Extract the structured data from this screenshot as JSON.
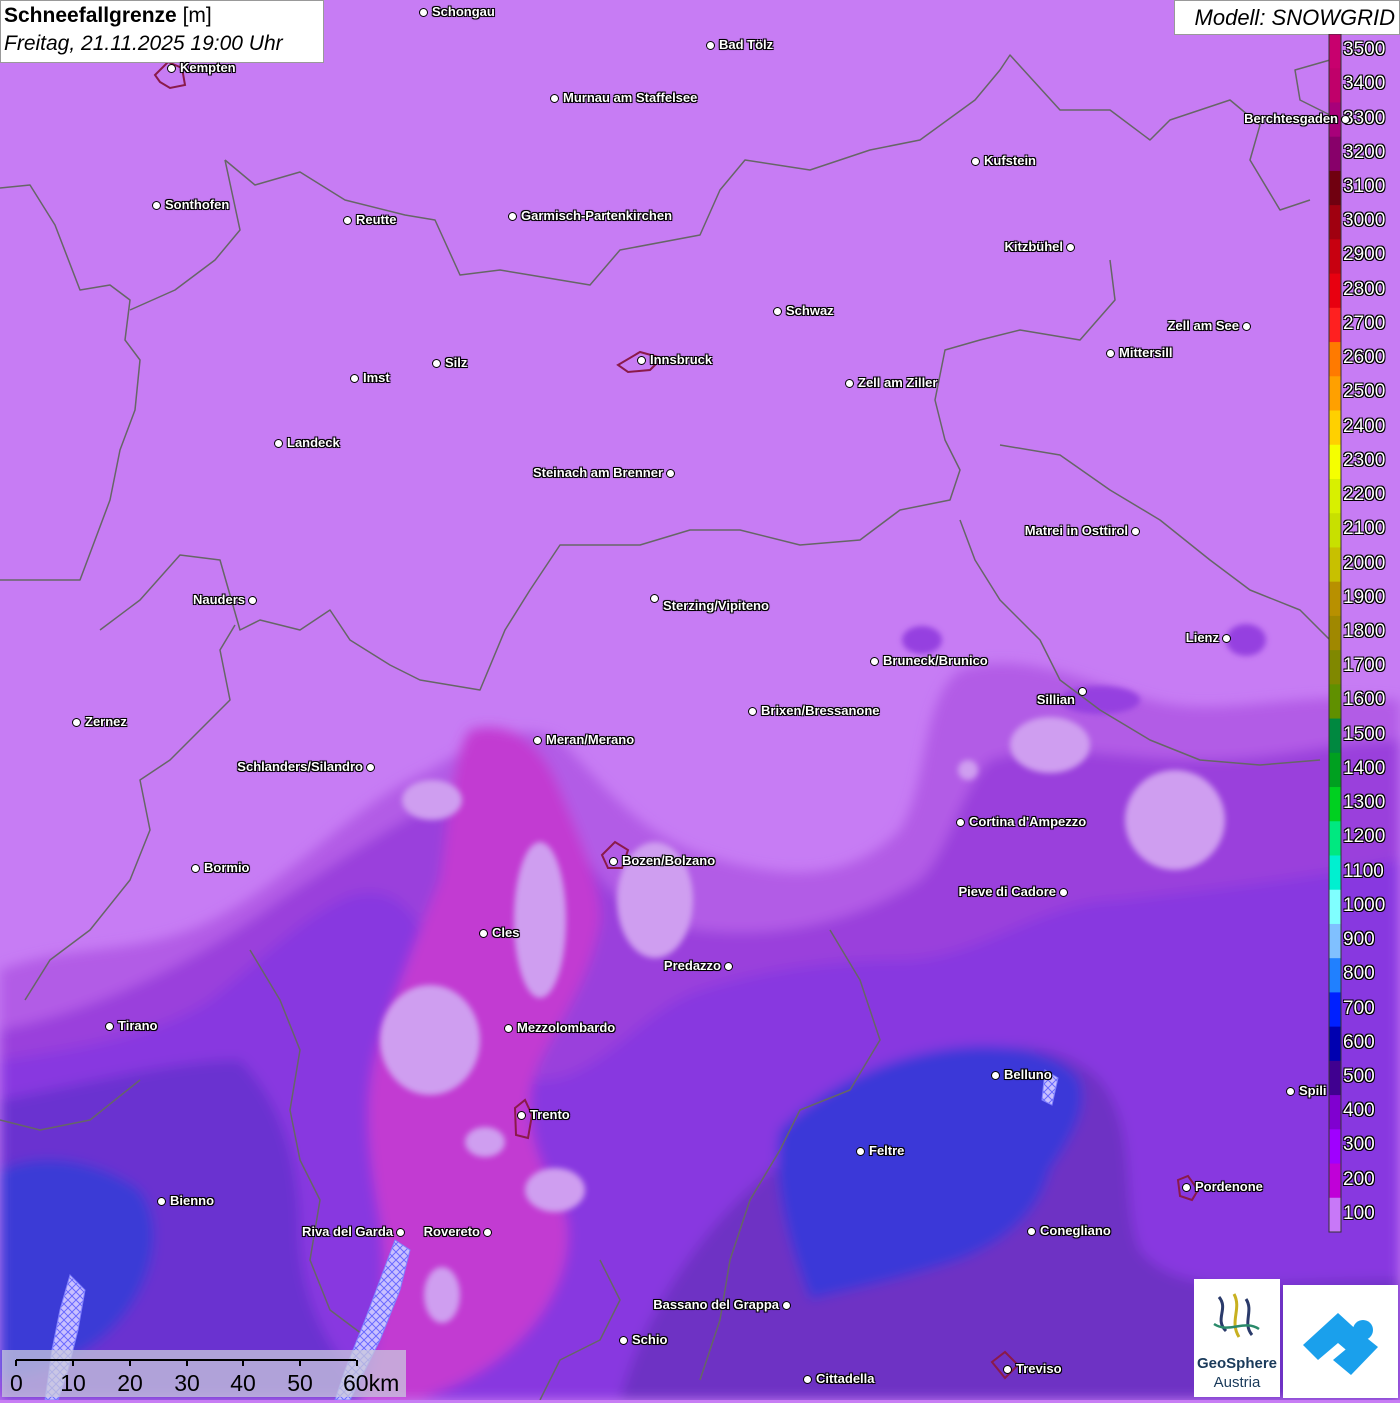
{
  "title": {
    "variable": "Schneefallgrenze",
    "unit": "[m]",
    "datetime": "Freitag, 21.11.2025 19:00 Uhr"
  },
  "model": "Modell: SNOWGRID",
  "legend": {
    "labels": [
      "3500",
      "3400",
      "3300",
      "3200",
      "3100",
      "3000",
      "2900",
      "2800",
      "2700",
      "2600",
      "2500",
      "2400",
      "2300",
      "2200",
      "2100",
      "2000",
      "1900",
      "1800",
      "1700",
      "1600",
      "1500",
      "1400",
      "1300",
      "1200",
      "1100",
      "1000",
      "900",
      "800",
      "700",
      "600",
      "500",
      "400",
      "300",
      "200",
      "100"
    ],
    "colors": [
      "#c8006e",
      "#c0006a",
      "#a8007a",
      "#88006a",
      "#700010",
      "#a00010",
      "#c80010",
      "#e80010",
      "#ff2020",
      "#ff7a00",
      "#ffa000",
      "#ffd000",
      "#f5ff00",
      "#d8f000",
      "#c8e000",
      "#c8c000",
      "#b89000",
      "#a08800",
      "#808800",
      "#609000",
      "#008840",
      "#00a020",
      "#00d020",
      "#00e880",
      "#00f0d0",
      "#80ffff",
      "#80c0ff",
      "#2080ff",
      "#0020ff",
      "#0000b0",
      "#400090",
      "#8000d0",
      "#a000ff",
      "#c000d8",
      "#c878f8"
    ]
  },
  "cities": [
    {
      "name": "Schongau"
    },
    {
      "name": "Bad Tölz"
    },
    {
      "name": "Kempten"
    },
    {
      "name": "Murnau am Staffelsee"
    },
    {
      "name": "Berchtesgaden"
    },
    {
      "name": "Kufstein"
    },
    {
      "name": "Sonthofen"
    },
    {
      "name": "Reutte"
    },
    {
      "name": "Garmisch-Partenkirchen"
    },
    {
      "name": "Kitzbühel"
    },
    {
      "name": "Schwaz"
    },
    {
      "name": "Zell am See"
    },
    {
      "name": "Mittersill"
    },
    {
      "name": "Innsbruck"
    },
    {
      "name": "Imst"
    },
    {
      "name": "Silz"
    },
    {
      "name": "Zell am Ziller"
    },
    {
      "name": "Landeck"
    },
    {
      "name": "Steinach am Brenner"
    },
    {
      "name": "Matrei in Osttirol"
    },
    {
      "name": "Nauders"
    },
    {
      "name": "Sterzing/Vipiteno"
    },
    {
      "name": "Lienz"
    },
    {
      "name": "Bruneck/Brunico"
    },
    {
      "name": "Sillian"
    },
    {
      "name": "Zernez"
    },
    {
      "name": "Brixen/Bressanone"
    },
    {
      "name": "Meran/Merano"
    },
    {
      "name": "Schlanders/Silandro"
    },
    {
      "name": "Cortina d'Ampezzo"
    },
    {
      "name": "Bormio"
    },
    {
      "name": "Bozen/Bolzano"
    },
    {
      "name": "Pieve di Cadore"
    },
    {
      "name": "Cles"
    },
    {
      "name": "Predazzo"
    },
    {
      "name": "Tirano"
    },
    {
      "name": "Mezzolombardo"
    },
    {
      "name": "Belluno"
    },
    {
      "name": "Spili"
    },
    {
      "name": "Trento"
    },
    {
      "name": "Feltre"
    },
    {
      "name": "Pordenone"
    },
    {
      "name": "Bienno"
    },
    {
      "name": "Riva del Garda"
    },
    {
      "name": "Rovereto"
    },
    {
      "name": "Conegliano"
    },
    {
      "name": "Bassano del Grappa"
    },
    {
      "name": "Schio"
    },
    {
      "name": "Treviso"
    },
    {
      "name": "Cittadella"
    }
  ],
  "scale": {
    "labels": [
      "0",
      "10",
      "20",
      "30",
      "40",
      "50",
      "60km"
    ]
  },
  "logos": {
    "geosphere_line1": "GeoSphere",
    "geosphere_line2": "Austria"
  }
}
